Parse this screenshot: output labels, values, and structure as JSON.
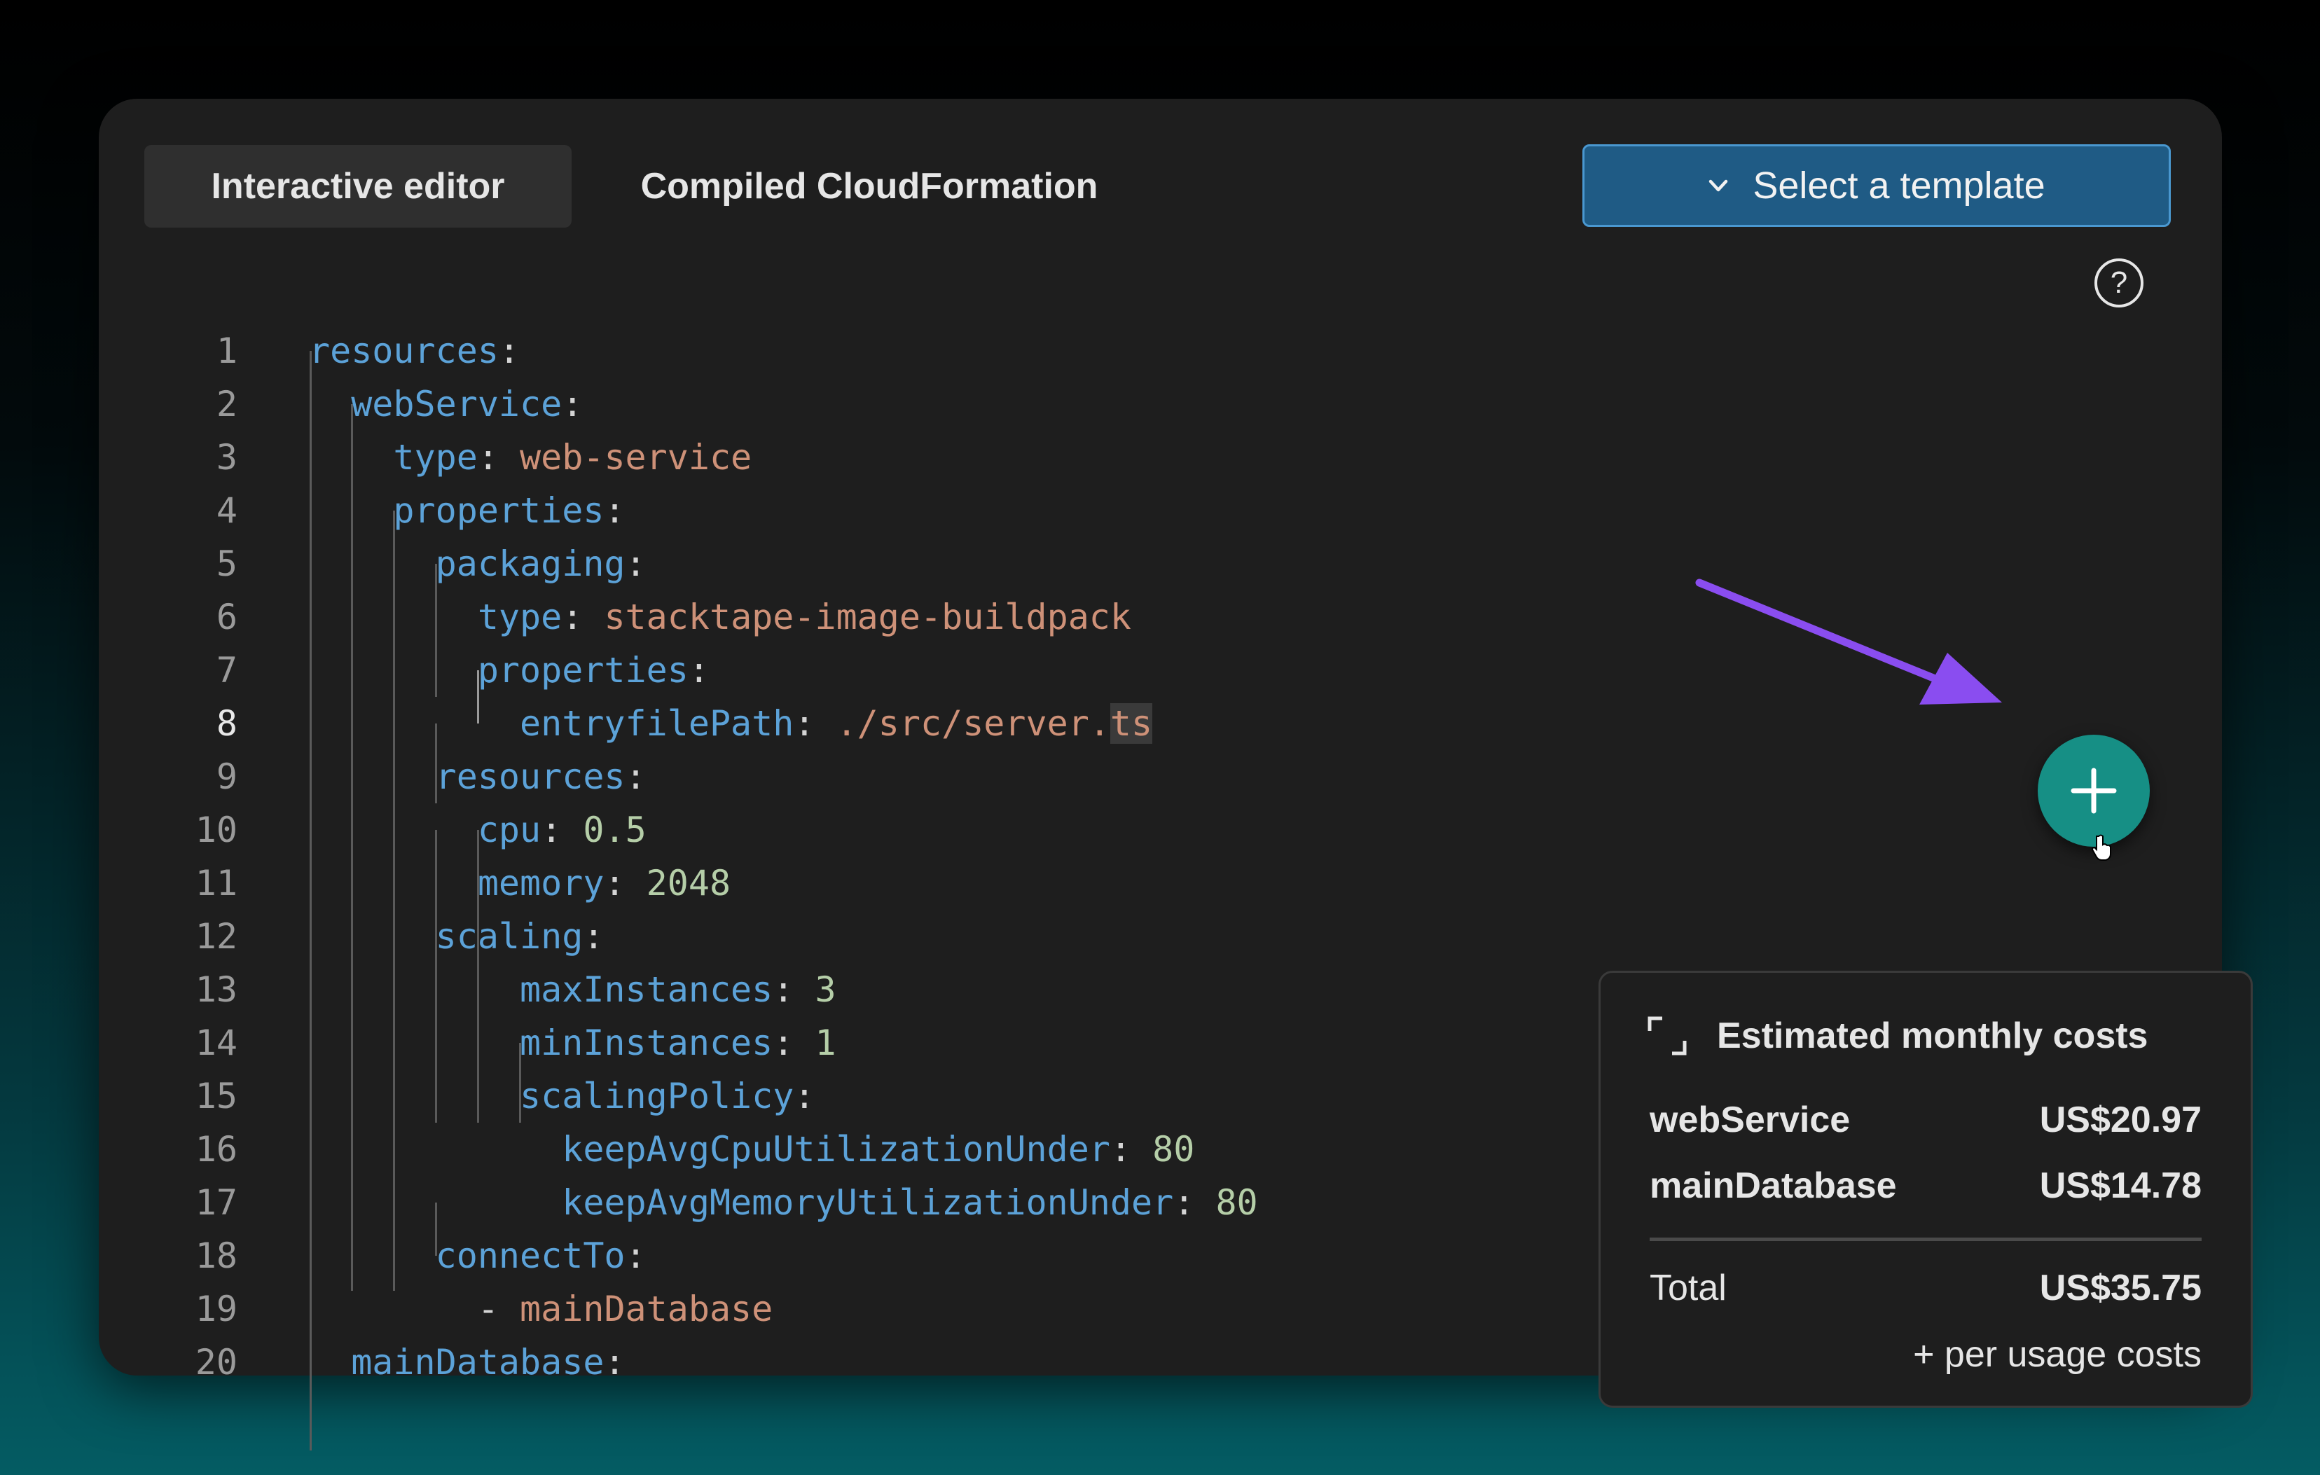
{
  "tabs": [
    {
      "label": "Interactive editor",
      "active": true
    },
    {
      "label": "Compiled CloudFormation",
      "active": false
    }
  ],
  "template_select": {
    "label": "Select a template"
  },
  "help": {
    "label": "?"
  },
  "editor": {
    "active_line": 8,
    "lines": [
      {
        "n": "1",
        "tokens": [
          {
            "t": "resources",
            "c": "k"
          },
          {
            "t": ":",
            "c": "p"
          }
        ]
      },
      {
        "n": "2",
        "tokens": [
          {
            "t": "  webService",
            "c": "k"
          },
          {
            "t": ":",
            "c": "p"
          }
        ]
      },
      {
        "n": "3",
        "tokens": [
          {
            "t": "    type",
            "c": "k"
          },
          {
            "t": ": ",
            "c": "p"
          },
          {
            "t": "web-service",
            "c": "s"
          }
        ]
      },
      {
        "n": "4",
        "tokens": [
          {
            "t": "    properties",
            "c": "k"
          },
          {
            "t": ":",
            "c": "p"
          }
        ]
      },
      {
        "n": "5",
        "tokens": [
          {
            "t": "      packaging",
            "c": "k"
          },
          {
            "t": ":",
            "c": "p"
          }
        ]
      },
      {
        "n": "6",
        "tokens": [
          {
            "t": "        type",
            "c": "k"
          },
          {
            "t": ": ",
            "c": "p"
          },
          {
            "t": "stacktape-image-buildpack",
            "c": "s"
          }
        ]
      },
      {
        "n": "7",
        "tokens": [
          {
            "t": "        properties",
            "c": "k"
          },
          {
            "t": ":",
            "c": "p"
          }
        ]
      },
      {
        "n": "8",
        "tokens": [
          {
            "t": "          entryfilePath",
            "c": "k"
          },
          {
            "t": ": ",
            "c": "p"
          },
          {
            "t": "./src/server.",
            "c": "s"
          },
          {
            "t": "ts",
            "c": "s sel"
          }
        ]
      },
      {
        "n": "9",
        "tokens": [
          {
            "t": "      resources",
            "c": "k"
          },
          {
            "t": ":",
            "c": "p"
          }
        ]
      },
      {
        "n": "10",
        "tokens": [
          {
            "t": "        cpu",
            "c": "k"
          },
          {
            "t": ": ",
            "c": "p"
          },
          {
            "t": "0.5",
            "c": "n"
          }
        ]
      },
      {
        "n": "11",
        "tokens": [
          {
            "t": "        memory",
            "c": "k"
          },
          {
            "t": ": ",
            "c": "p"
          },
          {
            "t": "2048",
            "c": "n"
          }
        ]
      },
      {
        "n": "12",
        "tokens": [
          {
            "t": "      scaling",
            "c": "k"
          },
          {
            "t": ":",
            "c": "p"
          }
        ]
      },
      {
        "n": "13",
        "tokens": [
          {
            "t": "          maxInstances",
            "c": "k"
          },
          {
            "t": ": ",
            "c": "p"
          },
          {
            "t": "3",
            "c": "n"
          }
        ]
      },
      {
        "n": "14",
        "tokens": [
          {
            "t": "          minInstances",
            "c": "k"
          },
          {
            "t": ": ",
            "c": "p"
          },
          {
            "t": "1",
            "c": "n"
          }
        ]
      },
      {
        "n": "15",
        "tokens": [
          {
            "t": "          scalingPolicy",
            "c": "k"
          },
          {
            "t": ":",
            "c": "p"
          }
        ]
      },
      {
        "n": "16",
        "tokens": [
          {
            "t": "            keepAvgCpuUtilizationUnder",
            "c": "k"
          },
          {
            "t": ": ",
            "c": "p"
          },
          {
            "t": "80",
            "c": "n"
          }
        ]
      },
      {
        "n": "17",
        "tokens": [
          {
            "t": "            keepAvgMemoryUtilizationUnder",
            "c": "k"
          },
          {
            "t": ": ",
            "c": "p"
          },
          {
            "t": "80",
            "c": "n"
          }
        ]
      },
      {
        "n": "18",
        "tokens": [
          {
            "t": "      connectTo",
            "c": "k"
          },
          {
            "t": ":",
            "c": "p"
          }
        ]
      },
      {
        "n": "19",
        "tokens": [
          {
            "t": "        - ",
            "c": "p"
          },
          {
            "t": "mainDatabase",
            "c": "s"
          }
        ]
      },
      {
        "n": "20",
        "tokens": [
          {
            "t": "  mainDatabase",
            "c": "k"
          },
          {
            "t": ":",
            "c": "p"
          }
        ]
      }
    ]
  },
  "costs": {
    "title": "Estimated monthly costs",
    "items": [
      {
        "name": "webService",
        "value": "US$20.97"
      },
      {
        "name": "mainDatabase",
        "value": "US$14.78"
      }
    ],
    "total_label": "Total",
    "total_value": "US$35.75",
    "usage_note": "+ per usage costs"
  },
  "colors": {
    "key": "#5ca2d8",
    "string": "#ce9178",
    "number": "#b5cea8",
    "accent_button": "#168f85",
    "template_button": "#1f5b85",
    "arrow": "#8a4df0"
  },
  "icons": {
    "template_select": "chevron-down-icon",
    "help": "question-circle-icon",
    "fab": "plus-icon",
    "costs": "expand-icon",
    "annotation": "arrow-icon",
    "cursor": "hand-pointer-icon"
  }
}
